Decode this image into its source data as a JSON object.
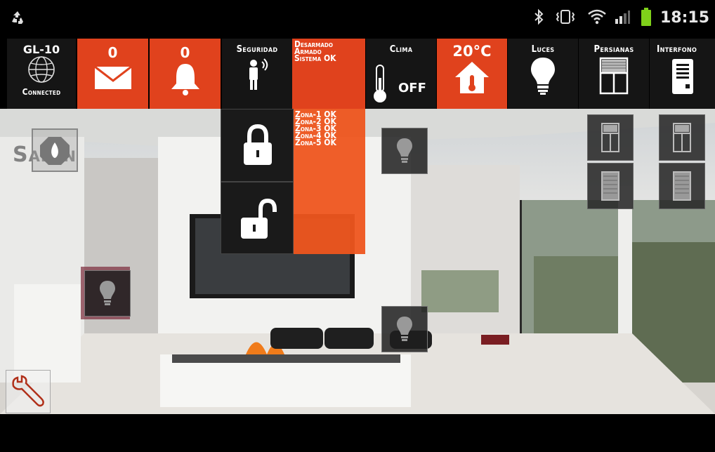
{
  "statusbar": {
    "time": "18:15",
    "icons": [
      "recycle-icon",
      "bluetooth-icon",
      "vibrate-icon",
      "wifi-icon",
      "signal-icon",
      "battery-icon"
    ]
  },
  "tiles": {
    "device": {
      "name": "GL-10",
      "status": "Connected"
    },
    "messages": {
      "count": "0"
    },
    "alarms": {
      "count": "0"
    },
    "security": {
      "label": "Seguridad",
      "status_lines": [
        "Desarmado",
        "Armado",
        "Sistema OK"
      ]
    },
    "climate": {
      "label": "Clima",
      "state": "OFF",
      "temperature": "20°C"
    },
    "lights": {
      "label": "Luces"
    },
    "blinds": {
      "label": "Persianas"
    },
    "intercom": {
      "label": "Interfono"
    }
  },
  "security_panel": {
    "zones": [
      "Zona-1 OK",
      "Zona-2 OK",
      "Zona-3 OK",
      "Zona-4 OK",
      "Zona-5 OK"
    ]
  },
  "room": {
    "name": "Salón"
  },
  "colors": {
    "accent": "#e0421d",
    "tile_dark": "#151515"
  }
}
